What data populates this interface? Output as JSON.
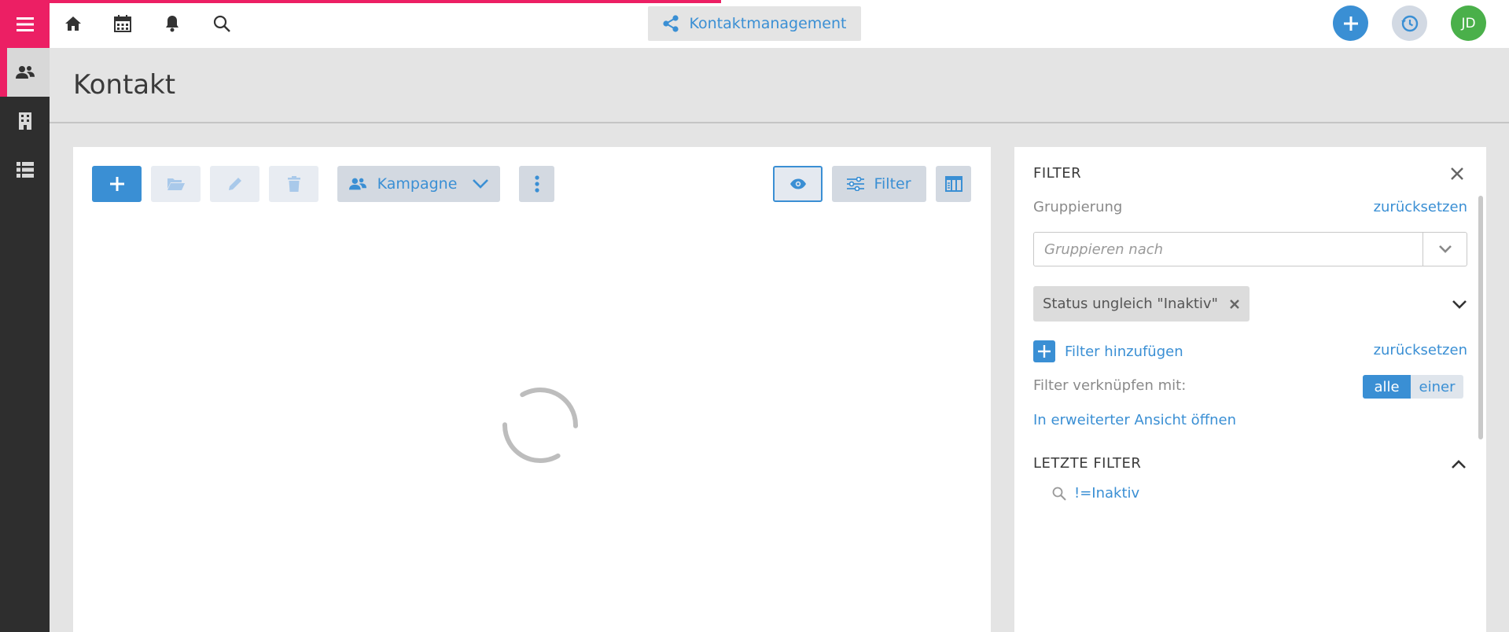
{
  "topbar": {
    "app_title": "Kontaktmanagement",
    "home_icon": "home-icon",
    "calendar_icon": "calendar-icon",
    "notifications_icon": "bell-icon",
    "search_icon": "search-icon",
    "user_initials": "JD",
    "accent": "#ec1f64",
    "loading_progress": 0.46
  },
  "sidebar": {
    "items": [
      {
        "icon": "contacts-icon",
        "active": true
      },
      {
        "icon": "building-icon",
        "active": false
      },
      {
        "icon": "list-icon",
        "active": false
      }
    ]
  },
  "page": {
    "title": "Kontakt"
  },
  "toolbar": {
    "campaign_label": "Kampagne",
    "filter_label": "Filter"
  },
  "filter_panel": {
    "title": "FILTER",
    "grouping_label": "Gruppierung",
    "reset_label": "zurücksetzen",
    "group_placeholder": "Gruppieren nach",
    "active_filter_chip": "Status ungleich \"Inaktiv\"",
    "add_filter_label": "Filter hinzufügen",
    "reset_filters_label": "zurücksetzen",
    "combine_label": "Filter verknüpfen mit:",
    "combine_options": [
      "alle",
      "einer"
    ],
    "combine_selected": "alle",
    "extended_view_link": "In erweiterter Ansicht öffnen",
    "recent_filters_title": "LETZTE FILTER",
    "recent_filters": [
      "!=Inaktiv"
    ]
  },
  "colors": {
    "primary": "#3a8fd4",
    "accent": "#ec1f64",
    "avatar": "#4ab04a"
  }
}
